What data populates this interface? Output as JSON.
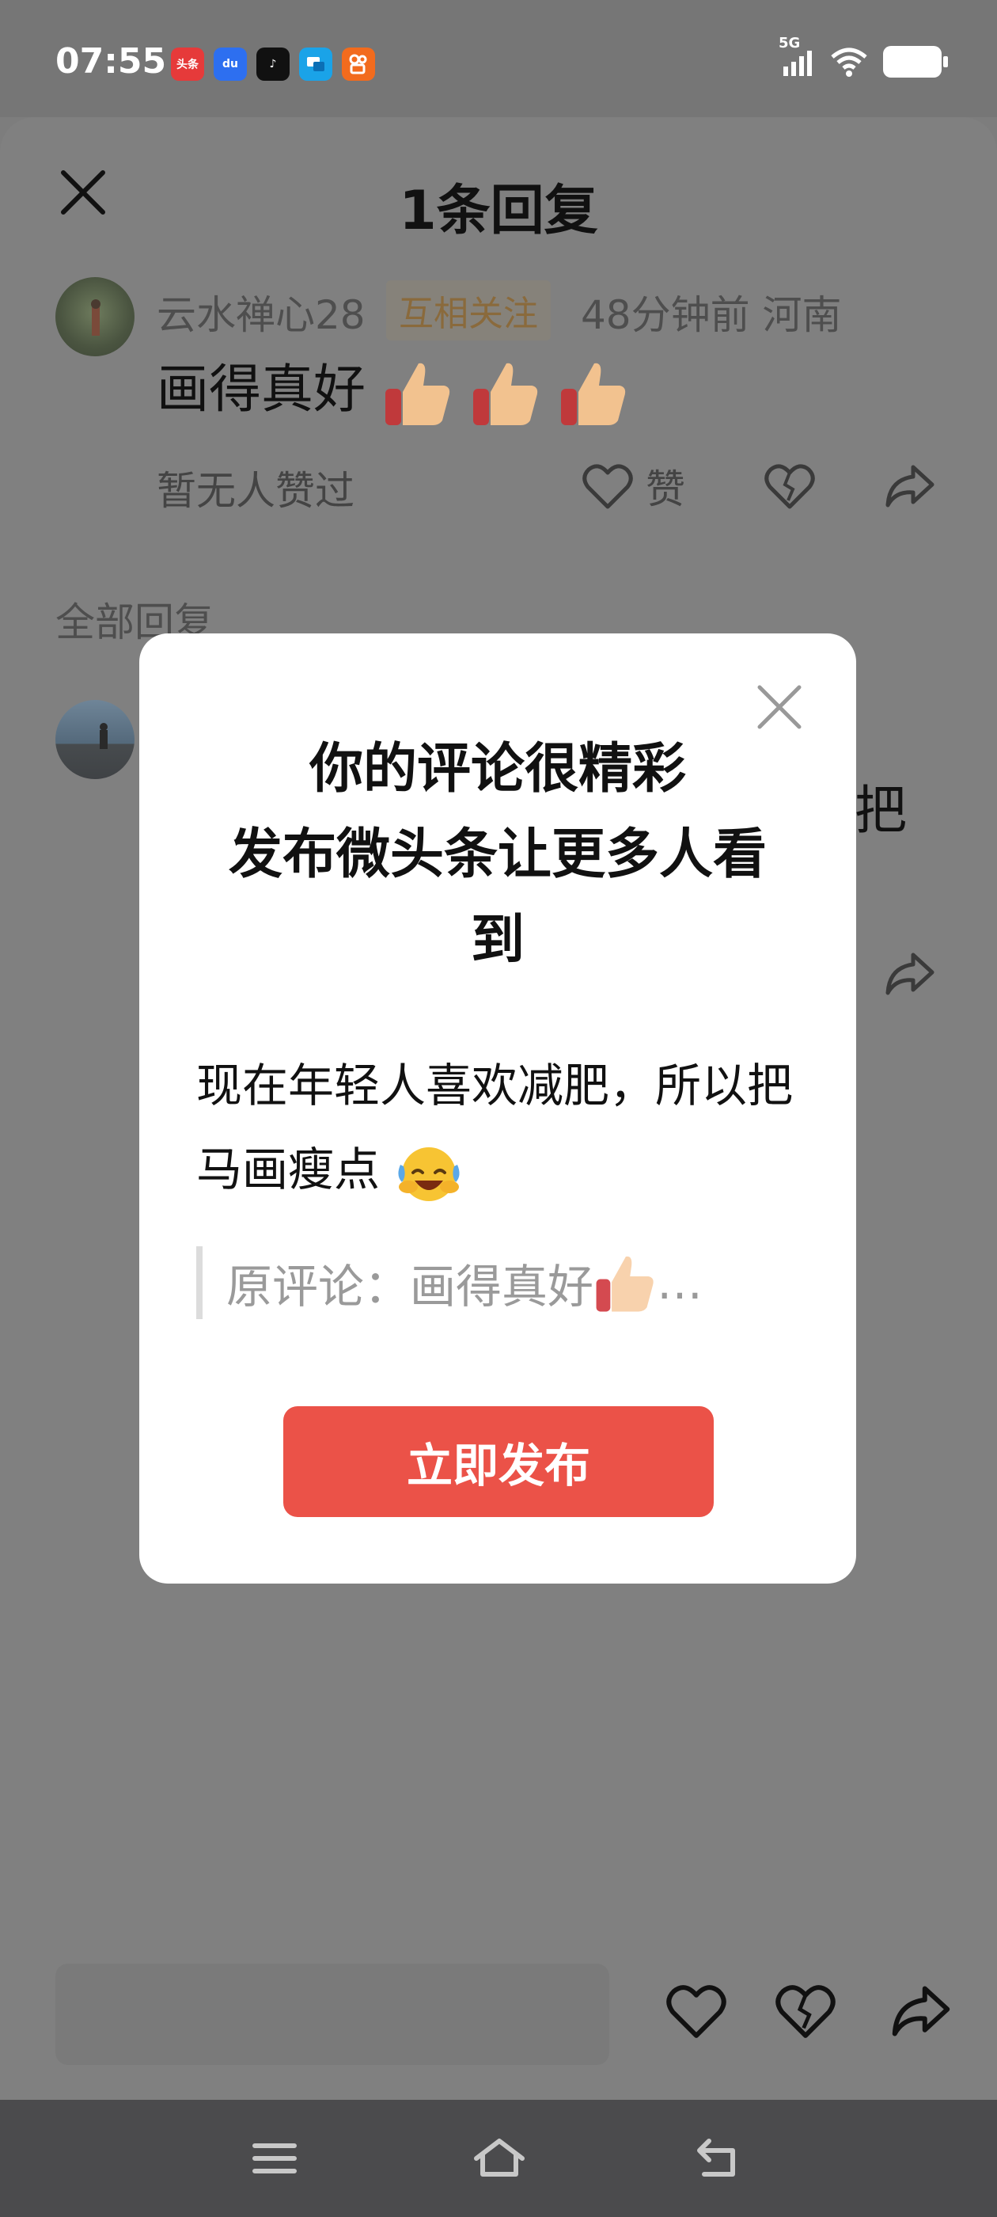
{
  "status_bar": {
    "time": "07:55",
    "network": "5G",
    "app_icons": [
      {
        "name": "toutiao-icon",
        "label": "头条",
        "color": "#e63a3a"
      },
      {
        "name": "baidu-icon",
        "label": "du",
        "color": "#2d6ff0"
      },
      {
        "name": "douyin-icon",
        "label": "♪",
        "color": "#111111"
      },
      {
        "name": "message-app-icon",
        "label": "",
        "color": "#1aa3e8"
      },
      {
        "name": "kuaishou-icon",
        "label": "",
        "color": "#f26b1d"
      }
    ]
  },
  "header": {
    "title": "1条回复"
  },
  "comment": {
    "username": "云水禅心28",
    "relation_tag": "互相关注",
    "time_location": "48分钟前   河南",
    "text": "画得真好",
    "likes_text": "暂无人赞过",
    "like_label": "赞"
  },
  "replies": {
    "section_title": "全部回复",
    "truncated_text": "把"
  },
  "dialog": {
    "title_lines": [
      "你的评论很精彩",
      "发布微头条让更多人看",
      "到"
    ],
    "body": "现在年轻人喜欢减肥，所以把马画瘦点",
    "quote": "原评论：画得真好",
    "quote_ellipsis": "…",
    "publish_label": "立即发布"
  },
  "colors": {
    "accent": "#eb5248",
    "overlay": "#808080",
    "nav_bar": "#4b4b4d"
  }
}
